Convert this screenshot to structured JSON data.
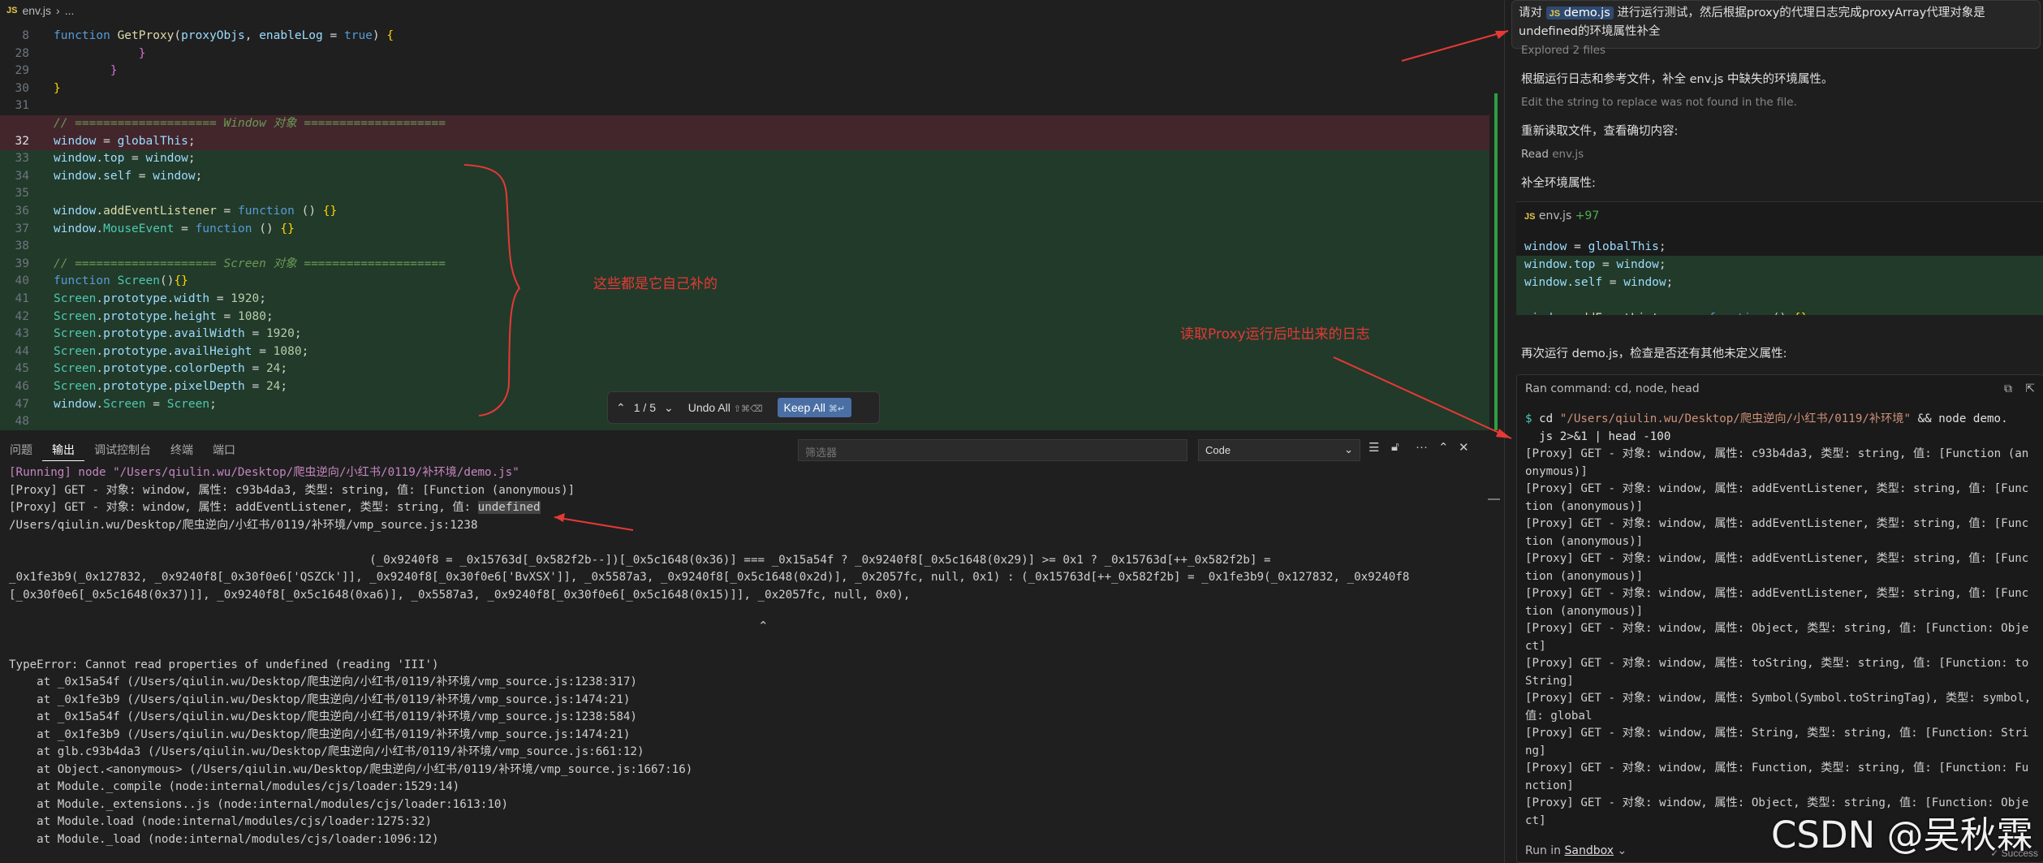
{
  "breadcrumb": {
    "file": "env.js",
    "rest": "..."
  },
  "code_lines": [
    {
      "n": "8",
      "bg": "",
      "html": [
        [
          "kw",
          "function "
        ],
        [
          "fn",
          "GetProxy"
        ],
        [
          "op",
          "("
        ],
        [
          "pr",
          "proxyObjs"
        ],
        [
          "op",
          ", "
        ],
        [
          "pr",
          "enableLog"
        ],
        [
          "op",
          " = "
        ],
        [
          "kw",
          "true"
        ],
        [
          "op",
          ") "
        ],
        [
          "brk",
          "{"
        ]
      ]
    },
    {
      "n": "28",
      "bg": "",
      "html": [
        [
          "op",
          "            "
        ],
        [
          "brk2",
          "}"
        ]
      ]
    },
    {
      "n": "29",
      "bg": "",
      "html": [
        [
          "op",
          "        "
        ],
        [
          "brk2",
          "}"
        ]
      ]
    },
    {
      "n": "30",
      "bg": "",
      "html": [
        [
          "brk",
          "}"
        ]
      ]
    },
    {
      "n": "31",
      "bg": "",
      "html": []
    },
    {
      "n": "",
      "bg": "bg-red",
      "html": [
        [
          "cm",
          "// ==================== Window 对象 ===================="
        ]
      ]
    },
    {
      "n": "32",
      "bg": "bg-red",
      "html": [
        [
          "ident",
          "window"
        ],
        [
          "op",
          " = "
        ],
        [
          "ident",
          "globalThis"
        ],
        [
          "op",
          ";"
        ]
      ]
    },
    {
      "n": "33",
      "bg": "bg-green",
      "html": [
        [
          "ident",
          "window"
        ],
        [
          "op",
          "."
        ],
        [
          "pr",
          "top"
        ],
        [
          "op",
          " = "
        ],
        [
          "ident",
          "window"
        ],
        [
          "op",
          ";"
        ]
      ]
    },
    {
      "n": "34",
      "bg": "bg-green",
      "html": [
        [
          "ident",
          "window"
        ],
        [
          "op",
          "."
        ],
        [
          "pr",
          "self"
        ],
        [
          "op",
          " = "
        ],
        [
          "ident",
          "window"
        ],
        [
          "op",
          ";"
        ]
      ]
    },
    {
      "n": "35",
      "bg": "bg-green",
      "html": []
    },
    {
      "n": "36",
      "bg": "bg-green",
      "html": [
        [
          "ident",
          "window"
        ],
        [
          "op",
          "."
        ],
        [
          "fn",
          "addEventListener"
        ],
        [
          "op",
          " = "
        ],
        [
          "kw",
          "function"
        ],
        [
          "op",
          " () "
        ],
        [
          "brk",
          "{}"
        ]
      ]
    },
    {
      "n": "37",
      "bg": "bg-green",
      "html": [
        [
          "ident",
          "window"
        ],
        [
          "op",
          "."
        ],
        [
          "cls",
          "MouseEvent"
        ],
        [
          "op",
          " = "
        ],
        [
          "kw",
          "function"
        ],
        [
          "op",
          " () "
        ],
        [
          "brk",
          "{}"
        ]
      ]
    },
    {
      "n": "38",
      "bg": "bg-green",
      "html": []
    },
    {
      "n": "39",
      "bg": "bg-green",
      "html": [
        [
          "cm",
          "// ==================== Screen 对象 ===================="
        ]
      ]
    },
    {
      "n": "40",
      "bg": "bg-green",
      "html": [
        [
          "kw",
          "function "
        ],
        [
          "cls",
          "Screen"
        ],
        [
          "op",
          "()"
        ],
        [
          "brk",
          "{}"
        ]
      ]
    },
    {
      "n": "41",
      "bg": "bg-green",
      "html": [
        [
          "cls",
          "Screen"
        ],
        [
          "op",
          "."
        ],
        [
          "pr",
          "prototype"
        ],
        [
          "op",
          "."
        ],
        [
          "pr",
          "width"
        ],
        [
          "op",
          " = "
        ],
        [
          "num",
          "1920"
        ],
        [
          "op",
          ";"
        ]
      ]
    },
    {
      "n": "42",
      "bg": "bg-green",
      "html": [
        [
          "cls",
          "Screen"
        ],
        [
          "op",
          "."
        ],
        [
          "pr",
          "prototype"
        ],
        [
          "op",
          "."
        ],
        [
          "pr",
          "height"
        ],
        [
          "op",
          " = "
        ],
        [
          "num",
          "1080"
        ],
        [
          "op",
          ";"
        ]
      ]
    },
    {
      "n": "43",
      "bg": "bg-green",
      "html": [
        [
          "cls",
          "Screen"
        ],
        [
          "op",
          "."
        ],
        [
          "pr",
          "prototype"
        ],
        [
          "op",
          "."
        ],
        [
          "pr",
          "availWidth"
        ],
        [
          "op",
          " = "
        ],
        [
          "num",
          "1920"
        ],
        [
          "op",
          ";"
        ]
      ]
    },
    {
      "n": "44",
      "bg": "bg-green",
      "html": [
        [
          "cls",
          "Screen"
        ],
        [
          "op",
          "."
        ],
        [
          "pr",
          "prototype"
        ],
        [
          "op",
          "."
        ],
        [
          "pr",
          "availHeight"
        ],
        [
          "op",
          " = "
        ],
        [
          "num",
          "1080"
        ],
        [
          "op",
          ";"
        ]
      ]
    },
    {
      "n": "45",
      "bg": "bg-green",
      "html": [
        [
          "cls",
          "Screen"
        ],
        [
          "op",
          "."
        ],
        [
          "pr",
          "prototype"
        ],
        [
          "op",
          "."
        ],
        [
          "pr",
          "colorDepth"
        ],
        [
          "op",
          " = "
        ],
        [
          "num",
          "24"
        ],
        [
          "op",
          ";"
        ]
      ]
    },
    {
      "n": "46",
      "bg": "bg-green",
      "html": [
        [
          "cls",
          "Screen"
        ],
        [
          "op",
          "."
        ],
        [
          "pr",
          "prototype"
        ],
        [
          "op",
          "."
        ],
        [
          "pr",
          "pixelDepth"
        ],
        [
          "op",
          " = "
        ],
        [
          "num",
          "24"
        ],
        [
          "op",
          ";"
        ]
      ]
    },
    {
      "n": "47",
      "bg": "bg-green",
      "html": [
        [
          "ident",
          "window"
        ],
        [
          "op",
          "."
        ],
        [
          "cls",
          "Screen"
        ],
        [
          "op",
          " = "
        ],
        [
          "cls",
          "Screen"
        ],
        [
          "op",
          ";"
        ]
      ]
    },
    {
      "n": "48",
      "bg": "bg-green",
      "html": []
    }
  ],
  "diffbar": {
    "counter": "1 / 5",
    "undo": "Undo All",
    "undo_short": "⇧⌘⌫",
    "keep": "Keep All",
    "keep_short": "⌘↵"
  },
  "annotations": {
    "self_patched": "这些都是它自己补的",
    "proxy_log": "读取Proxy运行后吐出来的日志"
  },
  "panel": {
    "tabs": [
      "问题",
      "输出",
      "调试控制台",
      "终端",
      "端口"
    ],
    "active_tab": "输出",
    "filter_placeholder": "筛选器",
    "output_select": "Code"
  },
  "output_lines": [
    "[Running] node \"/Users/qiulin.wu/Desktop/爬虫逆向/小红书/0119/补环境/demo.js\"",
    "[Proxy] GET - 对象: window, 属性: c93b4da3, 类型: string, 值: [Function (anonymous)]",
    "[Proxy] GET - 对象: window, 属性: addEventListener, 类型: string, 值: undefined",
    "/Users/qiulin.wu/Desktop/爬虫逆向/小红书/0119/补环境/vmp_source.js:1238",
    "",
    "                                                    (_0x9240f8 = _0x15763d[_0x582f2b--])[_0x5c1648(0x36)] === _0x15a54f ? _0x9240f8[_0x5c1648(0x29)] >= 0x1 ? _0x15763d[++_0x582f2b] =",
    "_0x1fe3b9(_0x127832, _0x9240f8[_0x30f0e6['QSZCk']], _0x9240f8[_0x30f0e6['BvXSX']], _0x5587a3, _0x9240f8[_0x5c1648(0x2d)], _0x2057fc, null, 0x1) : (_0x15763d[++_0x582f2b] = _0x1fe3b9(_0x127832, _0x9240f8",
    "[_0x30f0e6[_0x5c1648(0x37)]], _0x9240f8[_0x5c1648(0xa6)], _0x5587a3, _0x9240f8[_0x30f0e6[_0x5c1648(0x15)]], _0x2057fc, null, 0x0),",
    "",
    "",
    "",
    "TypeError: Cannot read properties of undefined (reading 'III')",
    "    at _0x15a54f (/Users/qiulin.wu/Desktop/爬虫逆向/小红书/0119/补环境/vmp_source.js:1238:317)",
    "    at _0x1fe3b9 (/Users/qiulin.wu/Desktop/爬虫逆向/小红书/0119/补环境/vmp_source.js:1474:21)",
    "    at _0x15a54f (/Users/qiulin.wu/Desktop/爬虫逆向/小红书/0119/补环境/vmp_source.js:1238:584)",
    "    at _0x1fe3b9 (/Users/qiulin.wu/Desktop/爬虫逆向/小红书/0119/补环境/vmp_source.js:1474:21)",
    "    at glb.c93b4da3 (/Users/qiulin.wu/Desktop/爬虫逆向/小红书/0119/补环境/vmp_source.js:661:12)",
    "    at Object.<anonymous> (/Users/qiulin.wu/Desktop/爬虫逆向/小红书/0119/补环境/vmp_source.js:1667:16)",
    "    at Module._compile (node:internal/modules/cjs/loader:1529:14)",
    "    at Module._extensions..js (node:internal/modules/cjs/loader:1613:10)",
    "    at Module.load (node:internal/modules/cjs/loader:1275:32)",
    "    at Module._load (node:internal/modules/cjs/loader:1096:12)"
  ],
  "chat": {
    "user_prefix": "请对",
    "user_file": "demo.js",
    "user_suffix": "进行运行测试，然后根据proxy的代理日志完成proxyArray代理对象是",
    "user_line2": "undefined的环境属性补全",
    "explored": "Explored 2 files",
    "msg1": "根据运行日志和参考文件，补全 env.js 中缺失的环境属性。",
    "msg2": "Edit the string to replace was not found in the file.",
    "msg3": "重新读取文件，查看确切内容:",
    "msg4_label": "Read",
    "msg4_file": "env.js",
    "msg5": "补全环境属性:",
    "card_file": "env.js",
    "card_add": "+97",
    "card_lines": [
      {
        "bg": "",
        "t": [
          [
            "ident",
            "window"
          ],
          [
            "op",
            " = "
          ],
          [
            "ident",
            "globalThis"
          ],
          [
            "op",
            ";"
          ]
        ]
      },
      {
        "bg": "bg-green",
        "t": [
          [
            "ident",
            "window"
          ],
          [
            "op",
            "."
          ],
          [
            "pr",
            "top"
          ],
          [
            "op",
            " = "
          ],
          [
            "ident",
            "window"
          ],
          [
            "op",
            ";"
          ]
        ]
      },
      {
        "bg": "bg-green",
        "t": [
          [
            "ident",
            "window"
          ],
          [
            "op",
            "."
          ],
          [
            "pr",
            "self"
          ],
          [
            "op",
            " = "
          ],
          [
            "ident",
            "window"
          ],
          [
            "op",
            ";"
          ]
        ]
      },
      {
        "bg": "bg-green",
        "t": []
      },
      {
        "bg": "bg-green",
        "t": [
          [
            "ident",
            "window"
          ],
          [
            "op",
            "."
          ],
          [
            "fn",
            "addEventListener"
          ],
          [
            "op",
            " = "
          ],
          [
            "kw",
            "function"
          ],
          [
            "op",
            " () "
          ],
          [
            "brk",
            "{}"
          ]
        ]
      }
    ],
    "msg6": "再次运行 demo.js，检查是否还有其他未定义属性:",
    "ran_command": "Ran command: cd, node, head",
    "cmd_prompt": "$",
    "cmd_cd": "cd",
    "cmd_path": "\"/Users/qiulin.wu/Desktop/爬虫逆向/小红书/0119/补环境\"",
    "cmd_rest": " && node demo.",
    "cmd_line2": "  js 2>&1 | head -100",
    "term_lines": [
      "[Proxy] GET - 对象: window, 属性: c93b4da3, 类型: string, 值: [Function (an",
      "onymous)]",
      "[Proxy] GET - 对象: window, 属性: addEventListener, 类型: string, 值: [Func",
      "tion (anonymous)]",
      "[Proxy] GET - 对象: window, 属性: addEventListener, 类型: string, 值: [Func",
      "tion (anonymous)]",
      "[Proxy] GET - 对象: window, 属性: addEventListener, 类型: string, 值: [Func",
      "tion (anonymous)]",
      "[Proxy] GET - 对象: window, 属性: addEventListener, 类型: string, 值: [Func",
      "tion (anonymous)]",
      "[Proxy] GET - 对象: window, 属性: Object, 类型: string, 值: [Function: Obje",
      "ct]",
      "[Proxy] GET - 对象: window, 属性: toString, 类型: string, 值: [Function: to",
      "String]",
      "[Proxy] GET - 对象: window, 属性: Symbol(Symbol.toStringTag), 类型: symbol,",
      "值: global",
      "[Proxy] GET - 对象: window, 属性: String, 类型: string, 值: [Function: Stri",
      "ng]",
      "[Proxy] GET - 对象: window, 属性: Function, 类型: string, 值: [Function: Fu",
      "nction]",
      "[Proxy] GET - 对象: window, 属性: Object, 类型: string, 值: [Function: Obje",
      "ct]"
    ],
    "run_in": "Run in",
    "sandbox": "Sandbox",
    "success": "Success"
  },
  "watermark": "CSDN @吴秋霖",
  "colors": {
    "annotation": "#e53935",
    "diff_green": "#223a2a",
    "diff_red": "#43262c",
    "keep_btn": "#4a6fa5"
  }
}
